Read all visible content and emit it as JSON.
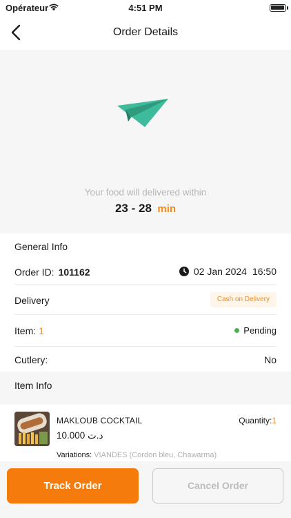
{
  "status_bar": {
    "carrier": "Opérateur",
    "time": "4:51 PM",
    "wifi_icon": "wifi-icon",
    "battery_icon": "battery-icon"
  },
  "nav": {
    "title": "Order Details",
    "back_icon": "chevron-left-icon"
  },
  "hero": {
    "icon": "paper-plane-icon",
    "caption": "Your food will delivered within",
    "eta_range": "23 - 28",
    "eta_unit": "min"
  },
  "general_info": {
    "heading": "General Info",
    "order_id_label": "Order ID:",
    "order_id": "101162",
    "date": "02 Jan 2024",
    "time": "16:50",
    "clock_icon": "clock-icon",
    "delivery_label": "Delivery",
    "payment_badge": "Cash on Delivery",
    "item_label": "Item:",
    "item_count": "1",
    "status": "Pending",
    "cutlery_label": "Cutlery:",
    "cutlery_value": "No"
  },
  "item_info": {
    "heading": "Item Info",
    "items": [
      {
        "name": "MAKLOUB COCKTAIL",
        "quantity_label": "Quantity:",
        "quantity": "1",
        "price": "10.000 د.ت",
        "variations_label": "Variations:",
        "variations_value": "VIANDES (Cordon bleu, Chawarma)"
      }
    ]
  },
  "footer": {
    "track_label": "Track Order",
    "cancel_label": "Cancel Order"
  },
  "colors": {
    "accent": "#f28b1b",
    "primary_button": "#f57c0c",
    "plane": "#3dbb9a",
    "status_pending": "#4caf50"
  }
}
